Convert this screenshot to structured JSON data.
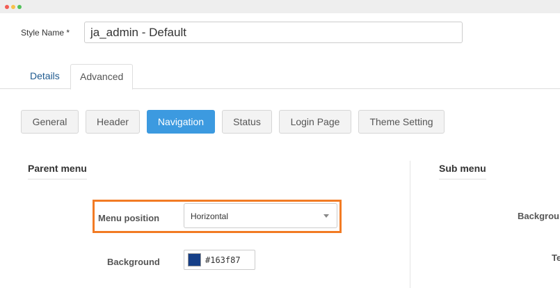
{
  "window": {
    "dots": [
      "#f25c54",
      "#f8c14a",
      "#52c25b"
    ]
  },
  "style": {
    "label": "Style Name *",
    "value": "ja_admin - Default"
  },
  "tabs": [
    {
      "label": "Details",
      "active": false
    },
    {
      "label": "Advanced",
      "active": true
    }
  ],
  "subtabs": [
    {
      "label": "General"
    },
    {
      "label": "Header"
    },
    {
      "label": "Navigation",
      "active": true
    },
    {
      "label": "Status"
    },
    {
      "label": "Login Page"
    },
    {
      "label": "Theme Setting"
    }
  ],
  "parent_menu": {
    "title": "Parent menu",
    "menu_position": {
      "label": "Menu position",
      "value": "Horizontal"
    },
    "background": {
      "label": "Background",
      "value": "#163f87",
      "swatch": "#163f87"
    }
  },
  "sub_menu": {
    "title": "Sub menu",
    "labels": [
      "Backgrou",
      "Te"
    ]
  },
  "colors": {
    "accent": "#3c9ae0",
    "highlight": "#f27b24"
  }
}
